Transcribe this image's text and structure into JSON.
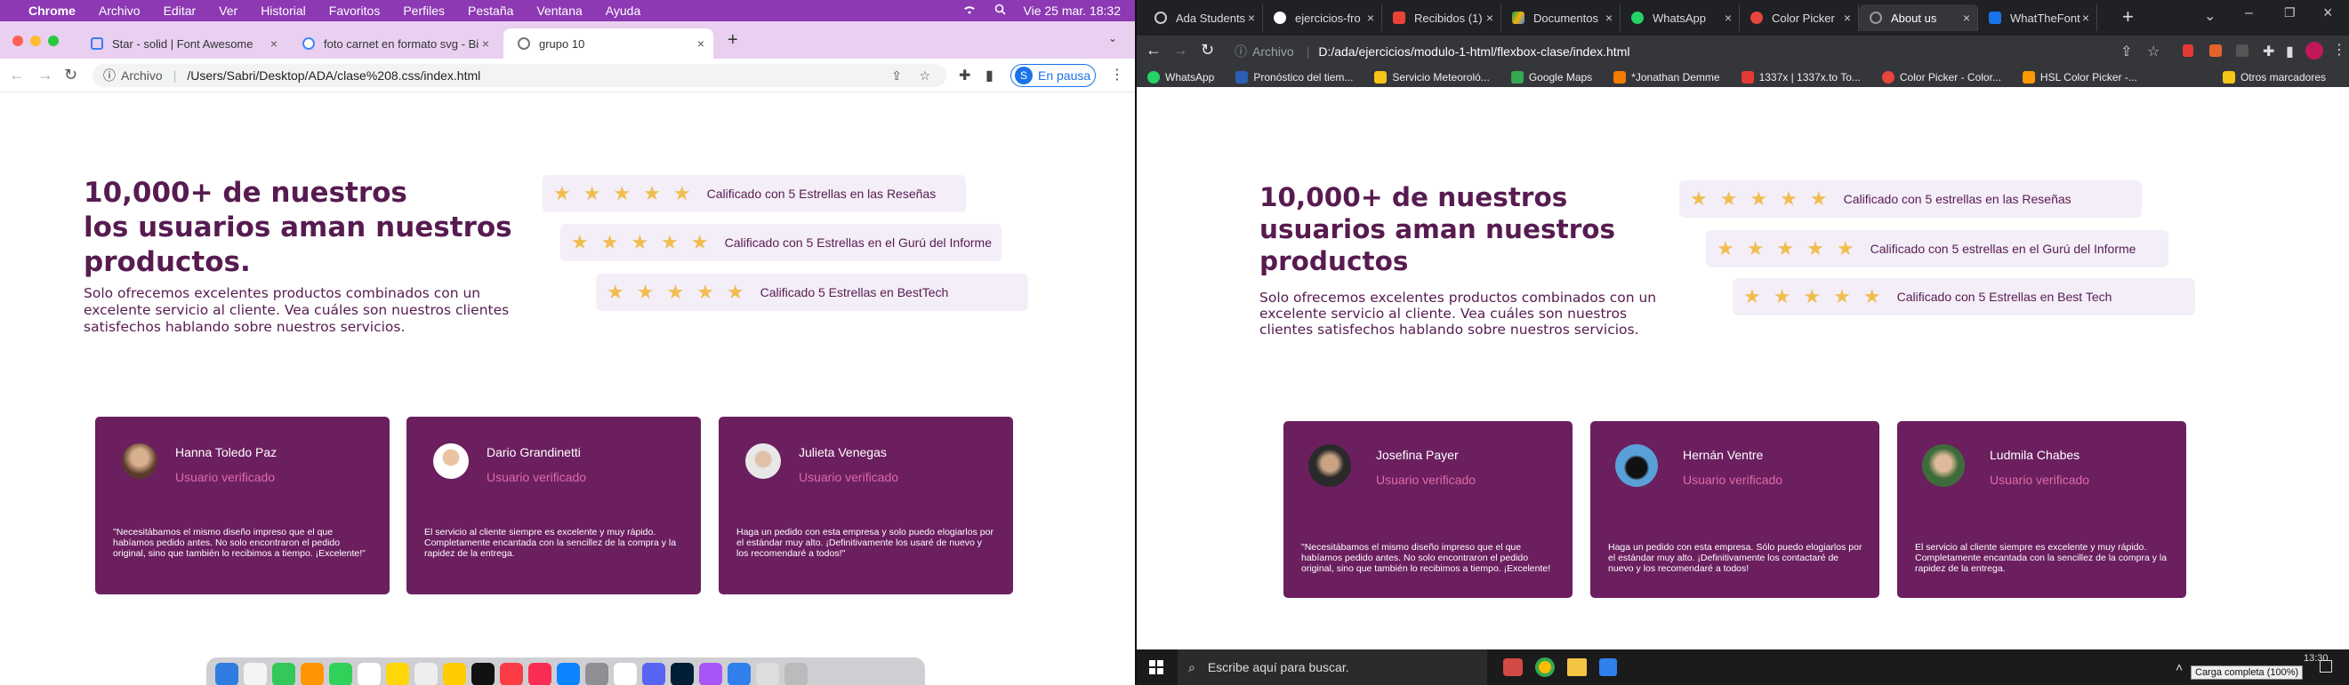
{
  "mac": {
    "menubar": {
      "apple": "",
      "items": [
        "Chrome",
        "Archivo",
        "Editar",
        "Ver",
        "Historial",
        "Favoritos",
        "Perfiles",
        "Pestaña",
        "Ventana",
        "Ayuda"
      ],
      "clock": "Vie 25 mar.  18:32"
    },
    "tabs": [
      {
        "label": "Star - solid | Font Awesome",
        "color": "#3a7cf0"
      },
      {
        "label": "foto carnet en formato svg - Bi",
        "color": "#4285f4"
      },
      {
        "label": "grupo 10",
        "color": "#777"
      }
    ],
    "address": {
      "prefix": "Archivo",
      "url": "/Users/Sabri/Desktop/ADA/clase%208.css/index.html",
      "profile_initial": "S",
      "pause_label": "En pausa"
    },
    "page": {
      "title": "10,000+ de nuestros los usuarios aman nuestros productos.",
      "title_lines": [
        "10,000+ de nuestros",
        "los usuarios aman nuestros",
        "productos."
      ],
      "text": "Solo ofrecemos excelentes productos combinados con un excelente servicio al cliente. Vea cuáles son nuestros clientes satisfechos hablando sobre nuestros servicios.",
      "ratings": [
        "Calificado con 5 Estrellas en las Reseñas",
        "Calificado con 5 Estrellas en el Gurú del Informe",
        "Calificado 5 Estrellas en BestTech"
      ],
      "stars": "★★★★★",
      "star_count": 5,
      "cards": [
        {
          "name": "Hanna Toledo Paz",
          "verified": "Usuario verificado",
          "quote": "\"Necesitábamos el mismo diseño impreso que el que habíamos pedido antes. No solo encontraron el pedido original, sino que también lo recibimos a tiempo. ¡Excelente!\""
        },
        {
          "name": "Dario Grandinetti",
          "verified": "Usuario verificado",
          "quote": "El servicio al cliente siempre es excelente y muy rápido. Completamente encantada con la sencillez de la compra y la rapidez de la entrega."
        },
        {
          "name": "Julieta Venegas",
          "verified": "Usuario verificado",
          "quote": "Haga un pedido con esta empresa y solo puedo elogiarlos por el estándar muy alto. ¡Definitivamente los usaré de nuevo y los recomendaré a todos!\""
        }
      ]
    }
  },
  "win": {
    "tabs": [
      {
        "label": "Ada Students",
        "color": "#ccc"
      },
      {
        "label": "ejercicios-fro",
        "color": "#fff"
      },
      {
        "label": "Recibidos (1)",
        "color": "#ea4335"
      },
      {
        "label": "Documentos",
        "color": "#4285f4"
      },
      {
        "label": "WhatsApp",
        "color": "#25d366"
      },
      {
        "label": "Color Picker",
        "color": "#e8453c"
      },
      {
        "label": "About us",
        "color": "#999"
      },
      {
        "label": "WhatTheFont",
        "color": "#1a73e8"
      }
    ],
    "address": {
      "prefix": "Archivo",
      "url": "D:/ada/ejercicios/modulo-1-html/flexbox-clase/index.html"
    },
    "bookmarks": [
      {
        "label": "WhatsApp",
        "color": "#25d366"
      },
      {
        "label": "Pronóstico del tiem...",
        "color": "#2c5fb3"
      },
      {
        "label": "Servicio Meteoroló...",
        "color": "#f5c518"
      },
      {
        "label": "Google Maps",
        "color": "#34a853"
      },
      {
        "label": "*Jonathan Demme",
        "color": "#f57c00"
      },
      {
        "label": "1337x | 1337x.to To...",
        "color": "#e53935"
      },
      {
        "label": "Color Picker - Color...",
        "color": "#e8453c"
      },
      {
        "label": "HSL Color Picker -...",
        "color": "#ff9800"
      }
    ],
    "other_bookmarks": "Otros marcadores",
    "page": {
      "title": "10,000+ de nuestros usuarios aman nuestros productos",
      "title_lines": [
        "10,000+ de nuestros",
        "usuarios aman nuestros",
        "productos"
      ],
      "text": "Solo ofrecemos excelentes productos combinados con un excelente servicio al cliente. Vea cuáles son nuestros clientes satisfechos hablando sobre nuestros servicios.",
      "ratings": [
        "Calificado con 5 estrellas en las Reseñas",
        "Calificado con 5 estrellas en el Gurú del Informe",
        "Calificado con 5 Estrellas en Best Tech"
      ],
      "stars": "★★★★★",
      "star_count": 5,
      "cards": [
        {
          "name": "Josefina Payer",
          "verified": "Usuario verificado",
          "quote": "\"Necesitábamos el mismo diseño impreso que el que habíamos pedido antes. No solo encontraron el pedido original, sino que también lo recibimos a tiempo. ¡Excelente!"
        },
        {
          "name": "Hernán Ventre",
          "verified": "Usuario verificado",
          "quote": "Haga un pedido con esta empresa. Sólo puedo elogiarlos por el estándar muy alto. ¡Definitivamente los contactaré de nuevo y los recomendaré a todos!"
        },
        {
          "name": "Ludmila Chabes",
          "verified": "Usuario verificado",
          "quote": "El servicio al cliente siempre es excelente y muy rápido. Completamente encantada con la sencillez de la compra y la rapidez de la entrega."
        }
      ]
    },
    "taskbar": {
      "search": "Escribe aquí para buscar.",
      "time": "13:30",
      "tooltip": "Carga completa (100%)"
    }
  },
  "colors": {
    "brand": "#571b50",
    "card": "#6b1f5f",
    "verified": "#e06aa8",
    "star": "#f0bd4f",
    "rating_bg": "#f4eef8"
  }
}
